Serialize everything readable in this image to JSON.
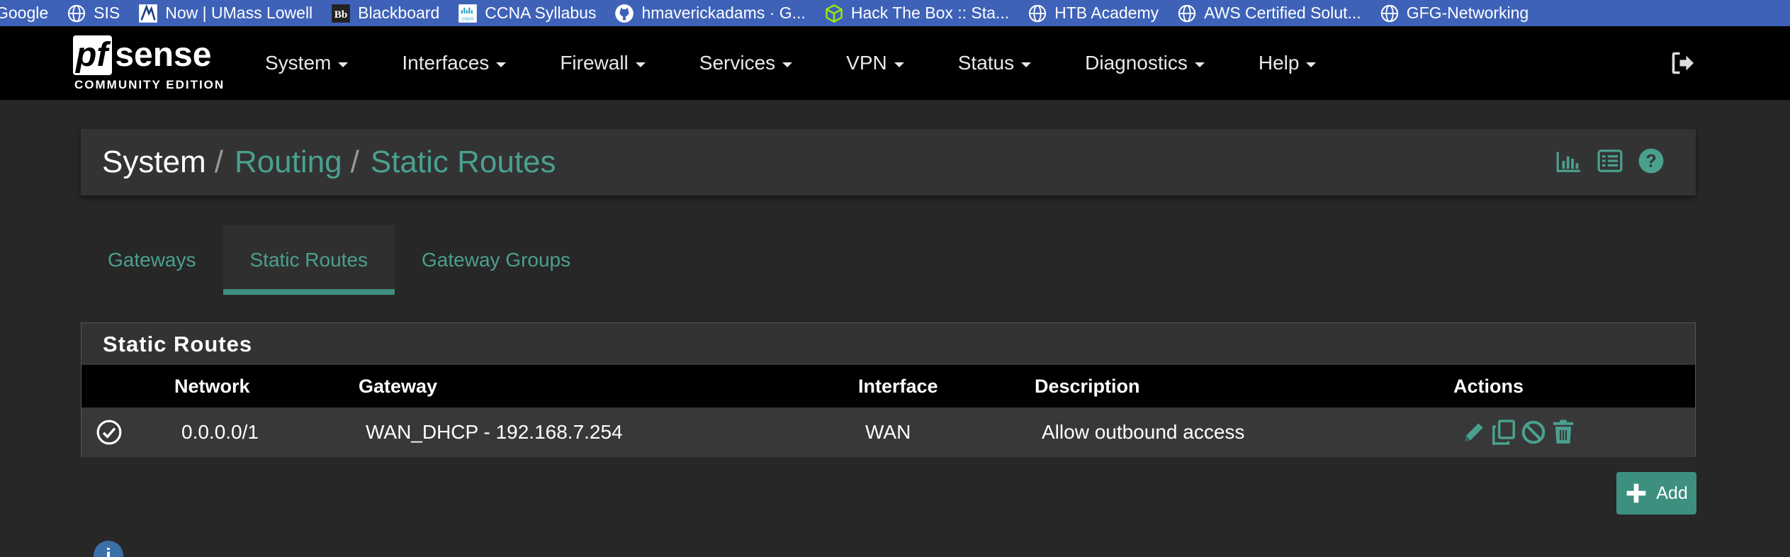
{
  "bookmarks": [
    {
      "label": "Google",
      "icon": "none"
    },
    {
      "label": "SIS",
      "icon": "globe-icon"
    },
    {
      "label": "Now | UMass Lowell",
      "icon": "umass-icon"
    },
    {
      "label": "Blackboard",
      "icon": "blackboard-icon"
    },
    {
      "label": "CCNA Syllabus",
      "icon": "cisco-icon"
    },
    {
      "label": "hmaverickadams · G...",
      "icon": "github-icon"
    },
    {
      "label": "Hack The Box :: Sta...",
      "icon": "htb-cube-icon"
    },
    {
      "label": "HTB Academy",
      "icon": "globe-icon"
    },
    {
      "label": "AWS Certified Solut...",
      "icon": "globe-icon"
    },
    {
      "label": "GFG-Networking",
      "icon": "globe-icon"
    }
  ],
  "brand": {
    "logo_pf": "pf",
    "logo_sense": "sense",
    "edition": "COMMUNITY EDITION"
  },
  "nav": [
    "System",
    "Interfaces",
    "Firewall",
    "Services",
    "VPN",
    "Status",
    "Diagnostics",
    "Help"
  ],
  "breadcrumb": {
    "root": "System",
    "sep": "/",
    "level2": "Routing",
    "level3": "Static Routes"
  },
  "tabs": [
    {
      "label": "Gateways",
      "active": false
    },
    {
      "label": "Static Routes",
      "active": true
    },
    {
      "label": "Gateway Groups",
      "active": false
    }
  ],
  "panel": {
    "title": "Static Routes",
    "columns": {
      "network": "Network",
      "gateway": "Gateway",
      "interface": "Interface",
      "description": "Description",
      "actions": "Actions"
    },
    "rows": [
      {
        "enabled": true,
        "network": "0.0.0.0/1",
        "gateway": "WAN_DHCP - 192.168.7.254",
        "interface": "WAN",
        "description": "Allow outbound access"
      }
    ]
  },
  "add_button": "Add",
  "colors": {
    "accent": "#3d8f80",
    "link": "#4aa08f",
    "bookmark_bar": "#3e62b8",
    "navbar": "#000000",
    "page_bg": "#272727",
    "panel_bg": "#333333"
  }
}
